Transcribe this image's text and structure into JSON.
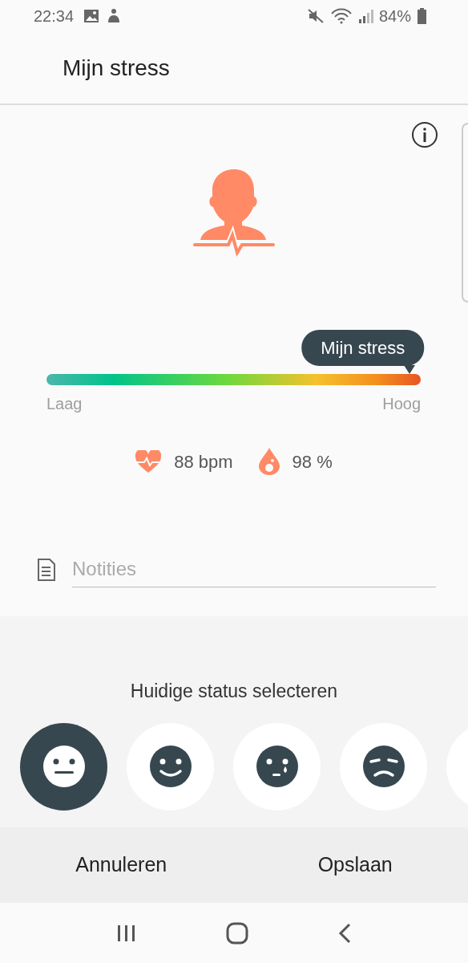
{
  "status_bar": {
    "time": "22:34",
    "battery": "84%"
  },
  "header": {
    "title": "Mijn stress"
  },
  "stress": {
    "tooltip": "Mijn stress",
    "level": 0.97,
    "low_label": "Laag",
    "high_label": "Hoog"
  },
  "vitals": [
    {
      "kind": "heart",
      "value": "88 bpm"
    },
    {
      "kind": "oxygen",
      "value": "98 %"
    }
  ],
  "notes": {
    "placeholder": "Notities"
  },
  "status_sheet": {
    "title": "Huidige status selecteren",
    "moods": [
      {
        "kind": "neutral",
        "selected": true
      },
      {
        "kind": "happy",
        "selected": false
      },
      {
        "kind": "crying",
        "selected": false
      },
      {
        "kind": "sad",
        "selected": false
      },
      {
        "kind": "hidden",
        "selected": false
      }
    ]
  },
  "buttons": [
    "Annuleren",
    "Opslaan"
  ]
}
